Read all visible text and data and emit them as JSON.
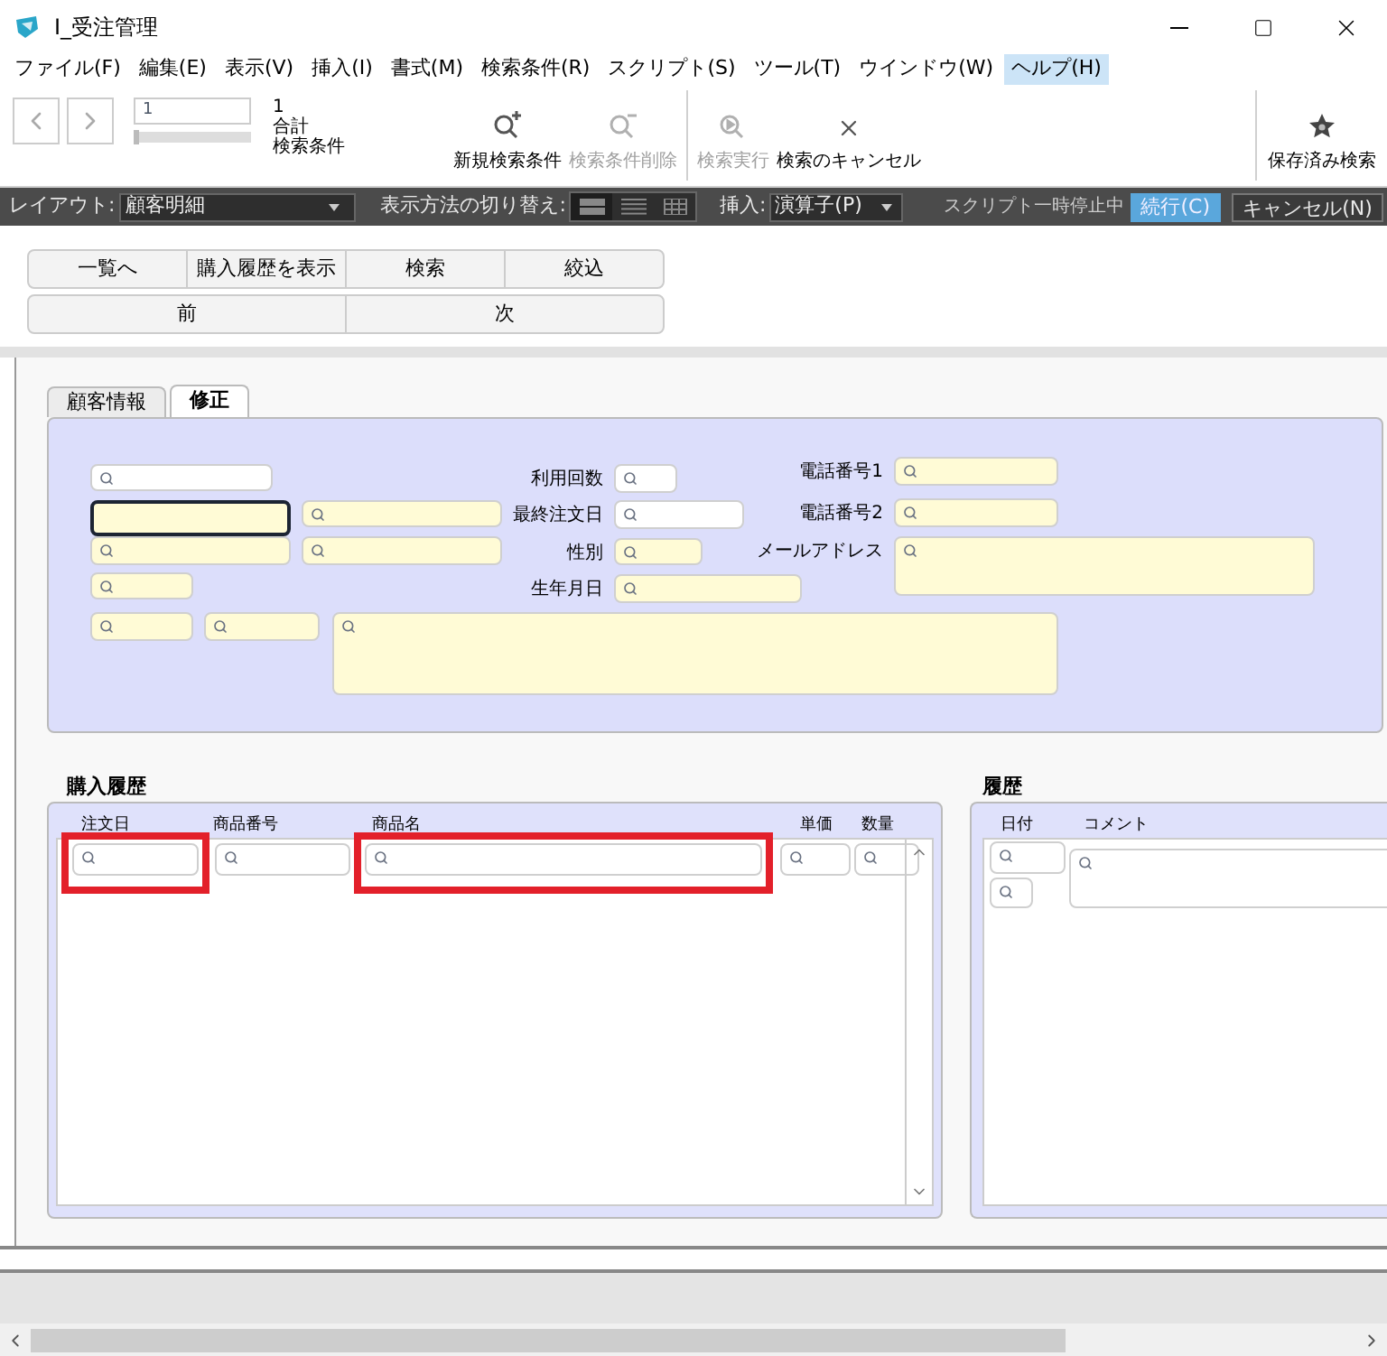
{
  "window": {
    "title": "I_受注管理"
  },
  "menu": [
    {
      "label": "ファイル(F)",
      "selected": false
    },
    {
      "label": "編集(E)",
      "selected": false
    },
    {
      "label": "表示(V)",
      "selected": false
    },
    {
      "label": "挿入(I)",
      "selected": false
    },
    {
      "label": "書式(M)",
      "selected": false
    },
    {
      "label": "検索条件(R)",
      "selected": false
    },
    {
      "label": "スクリプト(S)",
      "selected": false
    },
    {
      "label": "ツール(T)",
      "selected": false
    },
    {
      "label": "ウインドウ(W)",
      "selected": false
    },
    {
      "label": "ヘルプ(H)",
      "selected": true
    }
  ],
  "toolbar": {
    "record": "1",
    "count": "1",
    "total_label": "合計",
    "mode_label": "検索条件",
    "slider": {
      "level": 0
    },
    "buttons": [
      {
        "label": "新規検索条件",
        "kind": "new",
        "disabled": false
      },
      {
        "label": "検索条件削除",
        "kind": "delete",
        "disabled": true
      },
      {
        "label": "検索実行",
        "kind": "run",
        "disabled": true
      },
      {
        "label": "検索のキャンセル",
        "kind": "cancel",
        "disabled": false
      }
    ],
    "saved": {
      "label": "保存済み検索"
    }
  },
  "layout_bar": {
    "layout_label": "レイアウト:",
    "layout": "顧客明細",
    "view_label": "表示方法の切り替え:",
    "views": [
      {
        "kind": "form",
        "selected": true
      },
      {
        "kind": "list",
        "selected": false
      },
      {
        "kind": "table",
        "selected": false
      }
    ],
    "insert_label": "挿入:",
    "insert": "演算子(P)",
    "paused": "スクリプト一時停止中",
    "continue": "続行(C)",
    "cancel": "キャンセル(N)"
  },
  "nav_buttons": [
    [
      "一覧へ",
      "購入履歴を表示",
      "検索",
      "絞込"
    ],
    [
      "前",
      "次"
    ]
  ],
  "tabs": [
    {
      "label": "顧客情報",
      "selected": false
    },
    {
      "label": "修正",
      "selected": true
    }
  ],
  "fields": [
    {
      "kind": "white",
      "focused": false
    },
    {
      "kind": "yellow",
      "focused": true
    },
    {
      "kind": "yellow",
      "focused": false
    },
    {
      "kind": "yellow",
      "focused": false
    },
    {
      "kind": "yellow",
      "focused": false
    },
    {
      "kind": "yellow",
      "focused": false
    },
    {
      "kind": "yellow",
      "focused": false
    },
    {
      "kind": "yellow",
      "focused": false
    },
    {
      "kind": "yellow",
      "focused": false
    }
  ],
  "labeled_fields": [
    {
      "label": "利用回数",
      "kind": "white"
    },
    {
      "label": "最終注文日",
      "kind": "white"
    },
    {
      "label": "性別",
      "kind": "yellow"
    },
    {
      "label": "生年月日",
      "kind": "yellow"
    },
    {
      "label": "電話番号1",
      "kind": "yellow"
    },
    {
      "label": "電話番号2",
      "kind": "yellow"
    },
    {
      "label": "メールアドレス",
      "kind": "yellow"
    }
  ],
  "purchase_history": {
    "title": "購入履歴",
    "columns": [
      {
        "label": "注文日",
        "highlighted": true
      },
      {
        "label": "商品番号",
        "highlighted": false
      },
      {
        "label": "商品名",
        "highlighted": true
      },
      {
        "label": "単価",
        "highlighted": false
      },
      {
        "label": "数量",
        "highlighted": false
      }
    ]
  },
  "history": {
    "title": "履歴",
    "columns": [
      {
        "label": "日付"
      },
      {
        "label": "コメント"
      }
    ]
  }
}
